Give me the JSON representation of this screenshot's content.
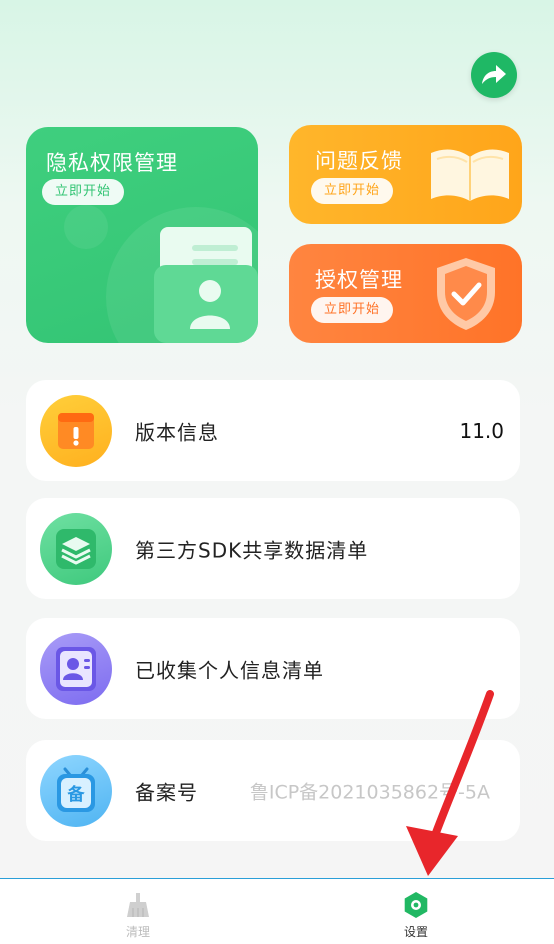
{
  "cards": {
    "privacy": {
      "title": "隐私权限管理",
      "button": "立即开始"
    },
    "feedback": {
      "title": "问题反馈",
      "button": "立即开始"
    },
    "authorization": {
      "title": "授权管理",
      "button": "立即开始"
    }
  },
  "rows": [
    {
      "label": "版本信息",
      "value": "11.0",
      "icon": "version-icon"
    },
    {
      "label": "第三方SDK共享数据清单",
      "value": "",
      "icon": "layers-icon"
    },
    {
      "label": "已收集个人信息清单",
      "value": "",
      "icon": "id-card-icon"
    },
    {
      "label": "备案号",
      "value": "鲁ICP备2021035862号-5A",
      "icon": "record-icon"
    }
  ],
  "tabbar": {
    "tabs": [
      {
        "label": "清理",
        "icon": "broom-icon",
        "active": false
      },
      {
        "label": "设置",
        "icon": "settings-icon",
        "active": true
      }
    ]
  },
  "colors": {
    "brand_green": "#1fb865",
    "feedback_orange": "#ffac22",
    "auth_orange": "#ff7a2f",
    "annotation_red": "#e8262b"
  }
}
